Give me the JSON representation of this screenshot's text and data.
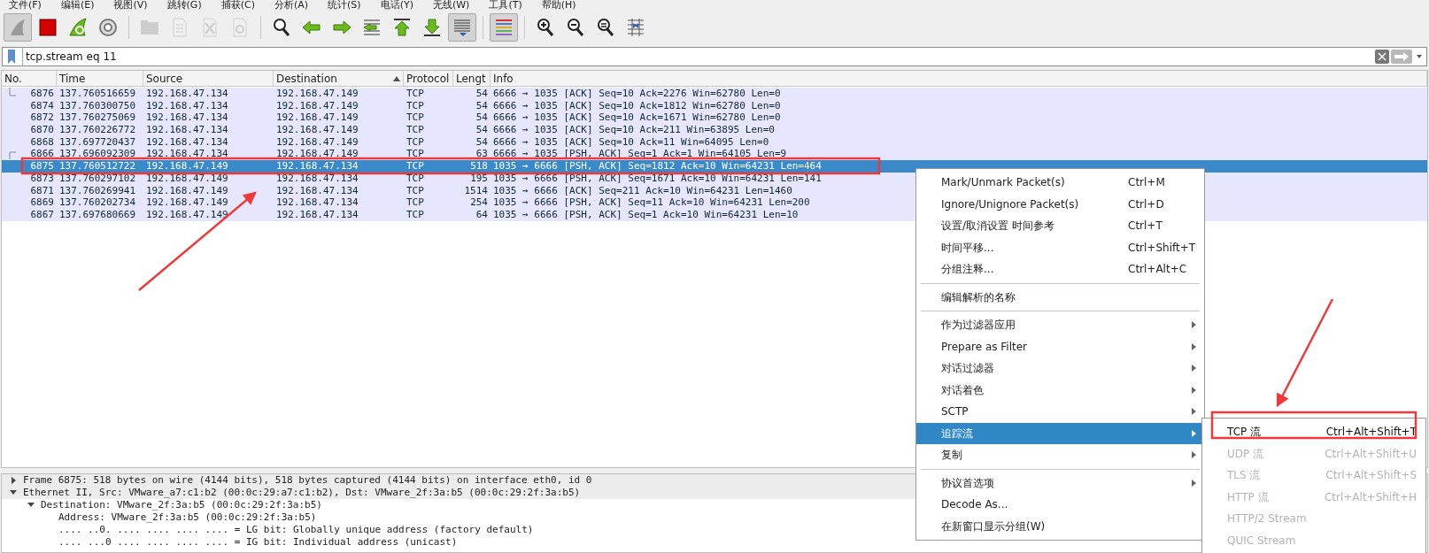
{
  "menu_bar": [
    "文件(F)",
    "编辑(E)",
    "视图(V)",
    "跳转(G)",
    "捕获(C)",
    "分析(A)",
    "统计(S)",
    "电话(Y)",
    "无线(W)",
    "工具(T)",
    "帮助(H)"
  ],
  "toolbar": [
    {
      "kind": "fin",
      "pressed": true,
      "disabled": false
    },
    {
      "kind": "stop",
      "pressed": false,
      "disabled": false
    },
    {
      "kind": "restart",
      "pressed": false,
      "disabled": false
    },
    {
      "kind": "options",
      "pressed": false,
      "disabled": false
    },
    {
      "kind": "separator"
    },
    {
      "kind": "open",
      "pressed": false,
      "disabled": true
    },
    {
      "kind": "save",
      "pressed": false,
      "disabled": true
    },
    {
      "kind": "close",
      "pressed": false,
      "disabled": true
    },
    {
      "kind": "reload",
      "pressed": false,
      "disabled": true
    },
    {
      "kind": "separator"
    },
    {
      "kind": "find",
      "pressed": false,
      "disabled": false
    },
    {
      "kind": "back",
      "pressed": false,
      "disabled": false
    },
    {
      "kind": "forward",
      "pressed": false,
      "disabled": false
    },
    {
      "kind": "goto",
      "pressed": false,
      "disabled": false
    },
    {
      "kind": "first",
      "pressed": false,
      "disabled": false
    },
    {
      "kind": "last",
      "pressed": false,
      "disabled": false
    },
    {
      "kind": "autoscroll",
      "pressed": true,
      "disabled": false
    },
    {
      "kind": "separator"
    },
    {
      "kind": "colorize",
      "pressed": true,
      "disabled": false
    },
    {
      "kind": "separator"
    },
    {
      "kind": "zoom-in",
      "pressed": false,
      "disabled": false
    },
    {
      "kind": "zoom-out",
      "pressed": false,
      "disabled": false
    },
    {
      "kind": "zoom-reset",
      "pressed": false,
      "disabled": false
    },
    {
      "kind": "resize",
      "pressed": false,
      "disabled": false
    }
  ],
  "filter": {
    "value": "tcp.stream eq 11"
  },
  "packet_list": {
    "columns": [
      {
        "label": "No."
      },
      {
        "label": "Time"
      },
      {
        "label": "Source"
      },
      {
        "label": "Destination",
        "sorted": true
      },
      {
        "label": "Protocol"
      },
      {
        "label": "Lengt"
      },
      {
        "label": "Info"
      }
    ],
    "rows": [
      {
        "kind": "conversation-end",
        "no": "6876",
        "time": "137.760516659",
        "source": "192.168.47.134",
        "destination": "192.168.47.149",
        "protocol": "TCP",
        "length": "54",
        "info": "6666 → 1035 [ACK] Seq=10 Ack=2276 Win=62780 Len=0",
        "selected": false
      },
      {
        "kind": "packet",
        "no": "6874",
        "time": "137.760300750",
        "source": "192.168.47.134",
        "destination": "192.168.47.149",
        "protocol": "TCP",
        "length": "54",
        "info": "6666 → 1035 [ACK] Seq=10 Ack=1812 Win=62780 Len=0",
        "selected": false
      },
      {
        "kind": "packet",
        "no": "6872",
        "time": "137.760275069",
        "source": "192.168.47.134",
        "destination": "192.168.47.149",
        "protocol": "TCP",
        "length": "54",
        "info": "6666 → 1035 [ACK] Seq=10 Ack=1671 Win=62780 Len=0",
        "selected": false
      },
      {
        "kind": "packet",
        "no": "6870",
        "time": "137.760226772",
        "source": "192.168.47.134",
        "destination": "192.168.47.149",
        "protocol": "TCP",
        "length": "54",
        "info": "6666 → 1035 [ACK] Seq=10 Ack=211 Win=63895 Len=0",
        "selected": false
      },
      {
        "kind": "packet",
        "no": "6868",
        "time": "137.697720437",
        "source": "192.168.47.134",
        "destination": "192.168.47.149",
        "protocol": "TCP",
        "length": "54",
        "info": "6666 → 1035 [ACK] Seq=10 Ack=11 Win=64095 Len=0",
        "selected": false
      },
      {
        "kind": "conversation-start",
        "no": "6866",
        "time": "137.696092309",
        "source": "192.168.47.134",
        "destination": "192.168.47.149",
        "protocol": "TCP",
        "length": "63",
        "info": "6666 → 1035 [PSH, ACK] Seq=1 Ack=1 Win=64105 Len=9",
        "selected": false
      },
      {
        "kind": "packet",
        "no": "6875",
        "time": "137.760512722",
        "source": "192.168.47.149",
        "destination": "192.168.47.134",
        "protocol": "TCP",
        "length": "518",
        "info": "1035 → 6666 [PSH, ACK] Seq=1812 Ack=10 Win=64231 Len=464",
        "selected": true
      },
      {
        "kind": "packet",
        "no": "6873",
        "time": "137.760297102",
        "source": "192.168.47.149",
        "destination": "192.168.47.134",
        "protocol": "TCP",
        "length": "195",
        "info": "1035 → 6666 [PSH, ACK] Seq=1671 Ack=10 Win=64231 Len=141",
        "selected": false
      },
      {
        "kind": "packet",
        "no": "6871",
        "time": "137.760269941",
        "source": "192.168.47.149",
        "destination": "192.168.47.134",
        "protocol": "TCP",
        "length": "1514",
        "info": "1035 → 6666 [ACK] Seq=211 Ack=10 Win=64231 Len=1460",
        "selected": false
      },
      {
        "kind": "packet",
        "no": "6869",
        "time": "137.760202734",
        "source": "192.168.47.149",
        "destination": "192.168.47.134",
        "protocol": "TCP",
        "length": "254",
        "info": "1035 → 6666 [PSH, ACK] Seq=11 Ack=10 Win=64231 Len=200",
        "selected": false
      },
      {
        "kind": "packet",
        "no": "6867",
        "time": "137.697680669",
        "source": "192.168.47.149",
        "destination": "192.168.47.134",
        "protocol": "TCP",
        "length": "64",
        "info": "1035 → 6666 [PSH, ACK] Seq=1 Ack=10 Win=64231 Len=10",
        "selected": false
      }
    ]
  },
  "details": [
    {
      "text": "Frame 6875: 518 bytes on wire (4144 bits), 518 bytes captured (4144 bits) on interface eth0, id 0",
      "expanded": false
    },
    {
      "text": "Ethernet II, Src: VMware_a7:c1:b2 (00:0c:29:a7:c1:b2), Dst: VMware_2f:3a:b5 (00:0c:29:2f:3a:b5)",
      "expanded": true,
      "children": [
        {
          "text": "Destination: VMware_2f:3a:b5 (00:0c:29:2f:3a:b5)",
          "expanded": true,
          "children": [
            {
              "text": "Address: VMware_2f:3a:b5 (00:0c:29:2f:3a:b5)"
            },
            {
              "text": ".... ..0. .... .... .... .... = LG bit: Globally unique address (factory default)"
            },
            {
              "text": ".... ...0 .... .... .... .... = IG bit: Individual address (unicast)"
            }
          ]
        }
      ]
    }
  ],
  "context_menu": [
    {
      "kind": "item",
      "label": "Mark/Unmark Packet(s)",
      "shortcut": "Ctrl+M",
      "submenu": false,
      "selected": false
    },
    {
      "kind": "item",
      "label": "Ignore/Unignore Packet(s)",
      "shortcut": "Ctrl+D",
      "submenu": false,
      "selected": false
    },
    {
      "kind": "item",
      "label": "设置/取消设置 时间参考",
      "shortcut": "Ctrl+T",
      "submenu": false,
      "selected": false
    },
    {
      "kind": "item",
      "label": "时间平移...",
      "shortcut": "Ctrl+Shift+T",
      "submenu": false,
      "selected": false
    },
    {
      "kind": "item",
      "label": "分组注释...",
      "shortcut": "Ctrl+Alt+C",
      "submenu": false,
      "selected": false
    },
    {
      "kind": "separator"
    },
    {
      "kind": "item",
      "label": "编辑解析的名称",
      "submenu": false,
      "selected": false
    },
    {
      "kind": "separator"
    },
    {
      "kind": "item",
      "label": "作为过滤器应用",
      "submenu": true,
      "selected": false
    },
    {
      "kind": "item",
      "label": "Prepare as Filter",
      "submenu": true,
      "selected": false
    },
    {
      "kind": "item",
      "label": "对话过滤器",
      "submenu": true,
      "selected": false
    },
    {
      "kind": "item",
      "label": "对话着色",
      "submenu": true,
      "selected": false
    },
    {
      "kind": "item",
      "label": "SCTP",
      "submenu": true,
      "selected": false
    },
    {
      "kind": "item",
      "label": "追踪流",
      "submenu": true,
      "selected": true
    },
    {
      "kind": "item",
      "label": "复制",
      "submenu": true,
      "selected": false
    },
    {
      "kind": "separator"
    },
    {
      "kind": "item",
      "label": "协议首选项",
      "submenu": true,
      "selected": false
    },
    {
      "kind": "item",
      "label": "Decode As...",
      "submenu": false,
      "selected": false
    },
    {
      "kind": "item",
      "label": "在新窗口显示分组(W)",
      "submenu": false,
      "selected": false
    }
  ],
  "submenu": [
    {
      "label": "TCP 流",
      "shortcut": "Ctrl+Alt+Shift+T",
      "disabled": false
    },
    {
      "label": "UDP 流",
      "shortcut": "Ctrl+Alt+Shift+U",
      "disabled": true
    },
    {
      "label": "TLS 流",
      "shortcut": "Ctrl+Alt+Shift+S",
      "disabled": true
    },
    {
      "label": "HTTP 流",
      "shortcut": "Ctrl+Alt+Shift+H",
      "disabled": true
    },
    {
      "label": "HTTP/2 Stream",
      "disabled": true
    },
    {
      "label": "QUIC Stream",
      "disabled": true
    }
  ]
}
